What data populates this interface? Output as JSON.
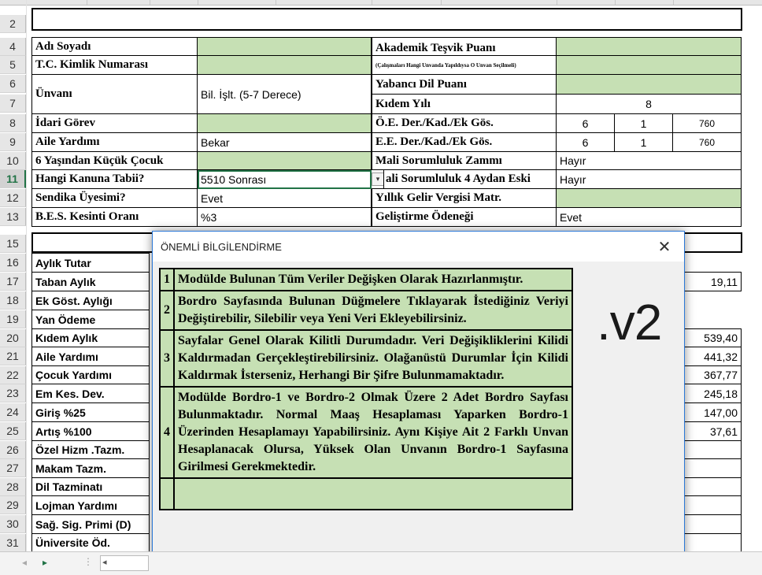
{
  "rows": [
    "2",
    "4",
    "5",
    "6",
    "7",
    "8",
    "9",
    "10",
    "11",
    "12",
    "13",
    "15",
    "16",
    "17",
    "18",
    "19",
    "20",
    "21",
    "22",
    "23",
    "24",
    "25",
    "26",
    "27",
    "28",
    "29",
    "30",
    "31"
  ],
  "selected_row": "11",
  "form": {
    "ad_soyadi": "Adı Soyadı",
    "tc": "T.C. Kimlik Numarası",
    "unvani": "Ünvanı",
    "unvani_val": "Bil. İşlt. (5-7 Derece)",
    "idari": "İdari Görev",
    "aile": "Aile Yardımı",
    "aile_val": "Bekar",
    "cocuk6": "6 Yaşından Küçük Çocuk",
    "kanun": "Hangi Kanuna Tabii?",
    "kanun_val": "5510 Sonrası",
    "sendika": "Sendika Üyesimi?",
    "sendika_val": "Evet",
    "bes": "B.E.S. Kesinti Oranı",
    "bes_val": "%3",
    "akademik": "Akademik Teşvik Puanı",
    "akademik_note": "(Çalışmaları Hangi Unvanda Yapıldıysa O Unvan Seçilmeli)",
    "yabanci": "Yabancı Dil Puanı",
    "kidem": "Kıdem Yılı",
    "kidem_val": "8",
    "oe": "Ö.E. Der./Kad./Ek Gös.",
    "oe_vals": [
      "6",
      "1",
      "760"
    ],
    "ee": "E.E. Der./Kad./Ek Gös.",
    "ee_vals": [
      "6",
      "1",
      "760"
    ],
    "mali": "Mali Sorumluluk Zammı",
    "mali_val": "Hayır",
    "mali4": "ali Sorumluluk 4 Aydan Eski",
    "mali4_val": "Hayır",
    "vergi": "Yıllık Gelir Vergisi Matr.",
    "gelistirme": "Geliştirme Ödeneği",
    "gelistirme_val": "Evet"
  },
  "pay_items": [
    "Aylık Tutar",
    "Taban Aylık",
    "Ek Göst. Aylığı",
    "Yan Ödeme",
    "Kıdem Aylık",
    "Aile Yardımı",
    "Çocuk Yardımı",
    "Em Kes. Dev.",
    "Giriş %25",
    "Artış %100",
    "Özel Hizm .Tazm.",
    "Makam Tazm.",
    "Dil Tazminatı",
    "Lojman Yardımı",
    "Sağ. Sig. Primi (D)",
    "Üniversite Öd."
  ],
  "right_values": {
    "r17": "19,11",
    "r20": "539,40",
    "r21": "441,32",
    "r22": "367,77",
    "r23": "245,18",
    "r24": "147,00",
    "r25": "37,61"
  },
  "dialog": {
    "title": "ÖNEMLİ BİLGİLENDİRME",
    "close": "✕",
    "version": ".v2",
    "items": [
      {
        "n": "1",
        "text": "Modülde Bulunan Tüm Veriler Değişken Olarak Hazırlanmıştır."
      },
      {
        "n": "2",
        "text": "Bordro Sayfasında Bulunan Düğmelere Tıklayarak İstediğiniz Veriyi Değiştirebilir, Silebilir veya Yeni Veri Ekleyebilirsiniz."
      },
      {
        "n": "3",
        "text": "Sayfalar Genel Olarak Kilitli Durumdadır. Veri Değişikliklerini Kilidi Kaldırmadan Gerçekleştirebilirsiniz. Olağanüstü Durumlar İçin Kilidi Kaldırmak İsterseniz, Herhangi Bir Şifre Bulunmamaktadır."
      },
      {
        "n": "4",
        "text": "Modülde Bordro-1 ve Bordro-2 Olmak Üzere 2 Adet Bordro Sayfası Bulunmaktadır. Normal Maaş Hesaplaması Yaparken Bordro-1 Üzerinden Hesaplamayı Yapabilirsiniz. Aynı Kişiye Ait 2 Farklı Unvan Hesaplanacak Olursa, Yüksek Olan Unvanın Bordro-1 Sayfasına Girilmesi Gerekmektedir."
      },
      {
        "n": "",
        "text": ""
      }
    ]
  },
  "sheet_nav": {
    "prev": "◂",
    "next": "▸",
    "more": "⋮"
  }
}
